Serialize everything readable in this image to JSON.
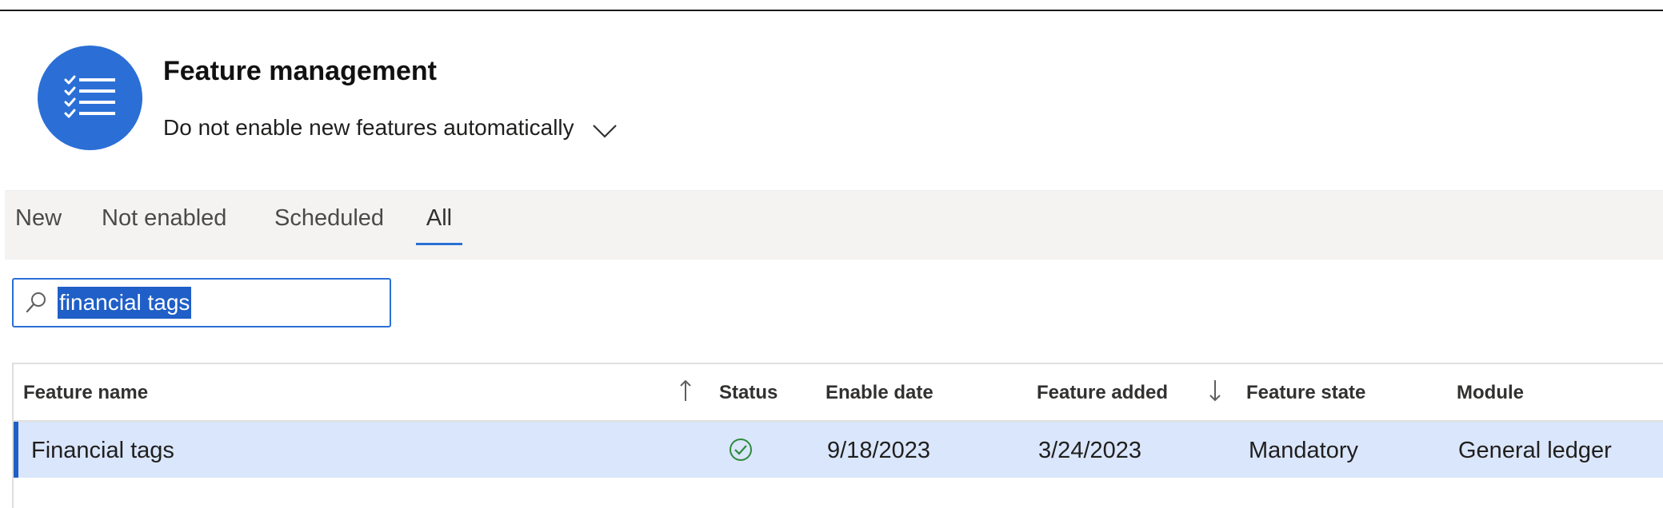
{
  "header": {
    "title": "Feature management",
    "auto_enable_option": "Do not enable new features automatically",
    "icon": "checklist-icon"
  },
  "tabs": [
    {
      "label": "New",
      "active": false
    },
    {
      "label": "Not enabled",
      "active": false
    },
    {
      "label": "Scheduled",
      "active": false
    },
    {
      "label": "All",
      "active": true
    }
  ],
  "search": {
    "value": "financial tags",
    "icon": "search-icon"
  },
  "grid": {
    "columns": [
      "Feature name",
      "Status",
      "Enable date",
      "Feature added",
      "Feature state",
      "Module"
    ],
    "sort": {
      "feature_name": "ascending",
      "feature_added": "descending"
    },
    "rows": [
      {
        "feature_name": "Financial tags",
        "status": "enabled",
        "enable_date": "9/18/2023",
        "feature_added": "3/24/2023",
        "feature_state": "Mandatory",
        "module": "General ledger",
        "selected": true
      }
    ]
  },
  "colors": {
    "accent": "#2b6fd6",
    "selected_row": "#dae6fb",
    "status_ok": "#2e8b3d"
  }
}
